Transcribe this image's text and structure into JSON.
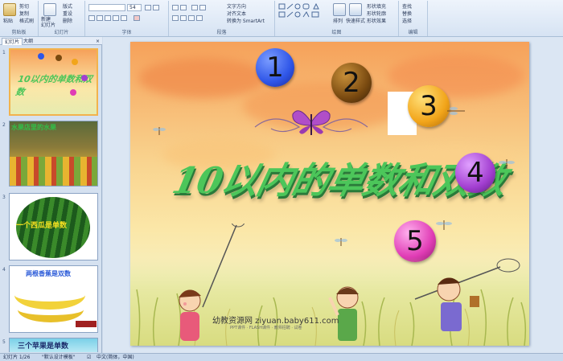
{
  "ribbon": {
    "groups": [
      "剪贴板",
      "幻灯片",
      "字体",
      "段落",
      "绘图",
      "编辑"
    ],
    "paste": "粘贴",
    "cut": "剪切",
    "copy": "复制",
    "format_painter": "格式刷",
    "new_slide": "新建\n幻灯片",
    "layout": "版式",
    "reset": "重设",
    "delete": "删除",
    "font_size": "54",
    "text_direction": "文字方向",
    "align_text": "对齐文本",
    "smartart": "转换为 SmartArt",
    "arrange": "排列",
    "quick_styles": "快速样式",
    "shape_fill": "形状填充",
    "shape_outline": "形状轮廓",
    "shape_effects": "形状效果",
    "find": "查找",
    "replace": "替换",
    "select": "选择"
  },
  "pane": {
    "tab_slides": "幻灯片",
    "tab_outline": "大纲",
    "thumbs": [
      {
        "num": "1",
        "title": "10以内的单数和双数"
      },
      {
        "num": "2",
        "title": "水果店里的水果"
      },
      {
        "num": "3",
        "title": "一个西瓜是单数"
      },
      {
        "num": "4",
        "title": "两根香蕉是双数"
      },
      {
        "num": "5",
        "title": "三个苹果是单数"
      }
    ]
  },
  "slide": {
    "title": "10以内的单数和双数",
    "numbers": [
      "1",
      "2",
      "3",
      "4",
      "5"
    ],
    "watermark": "幼教资源网 ziyuan.baby611.com",
    "watermark_sub": "PPT课件 · FLASH课件 · 教师招聘 · 试卷"
  },
  "status": {
    "slide_info": "幻灯片 1/26",
    "theme": "\"默认设计模板\"",
    "language": "中文(简体，中国)"
  },
  "colors": {
    "circle1": "#2f56e8",
    "circle2": "#7a4a10",
    "circle3": "#f2a51a",
    "circle4": "#a23ed0",
    "circle5": "#e03cb5",
    "title_green": "#4cc65a",
    "selected_border": "#f2b34d"
  }
}
